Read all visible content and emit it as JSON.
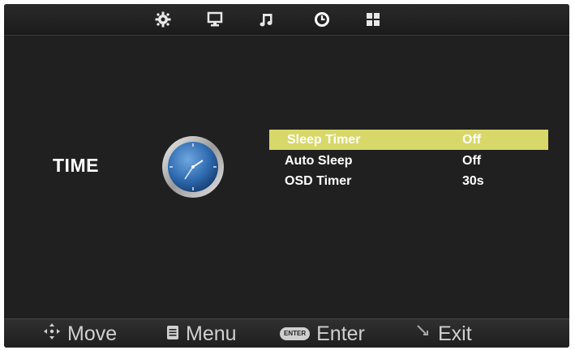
{
  "topbar": {
    "icons": [
      "gear-icon",
      "monitor-icon",
      "music-note-icon",
      "clock-icon",
      "grid-icon"
    ],
    "selected_index": 3
  },
  "section": {
    "title": "TIME",
    "icon": "clock-icon"
  },
  "menu": {
    "items": [
      {
        "label": "Sleep Timer",
        "value": "Off",
        "selected": true
      },
      {
        "label": "Auto Sleep",
        "value": "Off",
        "selected": false
      },
      {
        "label": "OSD Timer",
        "value": "30s",
        "selected": false
      }
    ],
    "highlight_color": "#d8d86a"
  },
  "help_bar": {
    "move": {
      "icon": "arrows-icon",
      "label": "Move"
    },
    "menu": {
      "icon": "menu-icon",
      "label": "Menu"
    },
    "enter": {
      "icon": "enter-icon",
      "icon_text": "ENTER",
      "label": "Enter"
    },
    "exit": {
      "icon": "exit-icon",
      "label": "Exit"
    }
  }
}
